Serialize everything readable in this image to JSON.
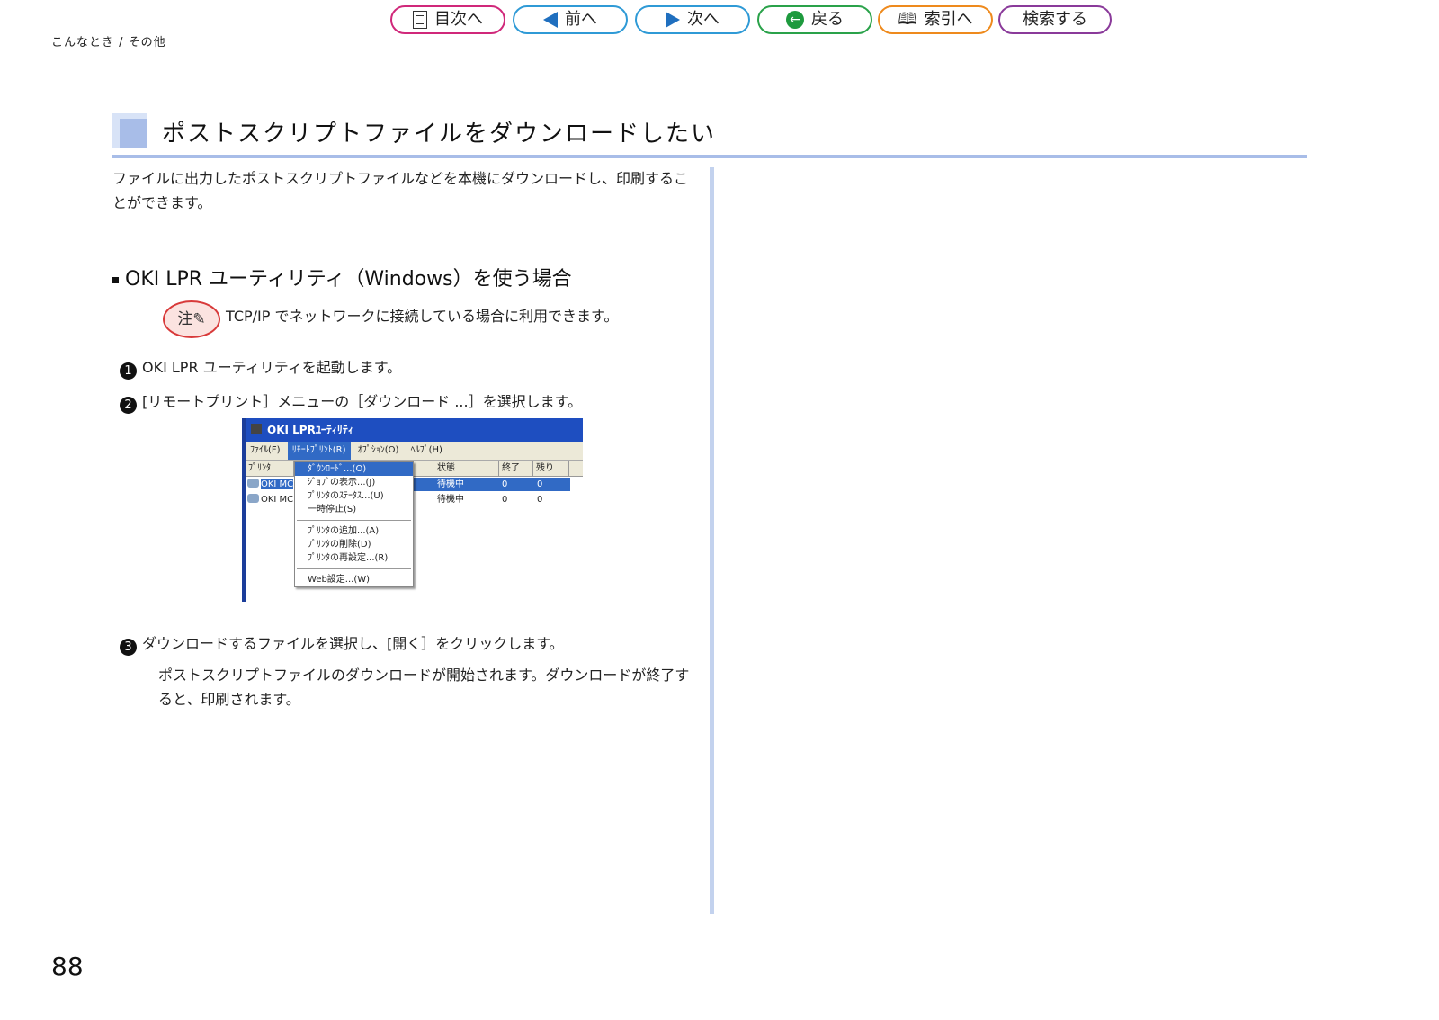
{
  "nav": {
    "toc": "目次へ",
    "prev": "前へ",
    "next": "次へ",
    "back": "戻る",
    "index": "索引へ",
    "search": "検索する"
  },
  "breadcrumb": "こんなとき / その他",
  "title": "ポストスクリプトファイルをダウンロードしたい",
  "intro": "ファイルに出力したポストスクリプトファイルなどを本機にダウンロードし、印刷することができます。",
  "section": {
    "heading": "OKI LPR ユーティリティ（Windows）を使う場合",
    "note_badge": "注",
    "note_text": "TCP/IP でネットワークに接続している場合に利用できます。"
  },
  "steps": [
    {
      "num": "1",
      "text": "OKI LPR ユーティリティを起動します。"
    },
    {
      "num": "2",
      "text": "[リモートプリント］メニューの［ダウンロード ...］を選択します。"
    },
    {
      "num": "3",
      "text": "ダウンロードするファイルを選択し、[開く］をクリックします。"
    }
  ],
  "result": "ポストスクリプトファイルのダウンロードが開始されます。ダウンロードが終了すると、印刷されます。",
  "screenshot": {
    "window_title": "OKI LPRﾕｰﾃｨﾘﾃｨ",
    "menus": [
      "ﾌｧｲﾙ(F)",
      "ﾘﾓｰﾄﾌﾟﾘﾝﾄ(R)",
      "ｵﾌﾟｼｮﾝ(O)",
      "ﾍﾙﾌﾟ(H)"
    ],
    "columns": [
      "ﾌﾟﾘﾝﾀ",
      "状態",
      "終了",
      "残り"
    ],
    "rows": [
      {
        "printer": "OKI MC",
        "status": "待機中",
        "done": "0",
        "remaining": "0"
      },
      {
        "printer": "OKI MC",
        "status": "待機中",
        "done": "0",
        "remaining": "0"
      }
    ],
    "dropdown": [
      "ﾀﾞｳﾝﾛｰﾄﾞ...(O)",
      "ｼﾞｮﾌﾞの表示...(J)",
      "ﾌﾟﾘﾝﾀのｽﾃｰﾀｽ...(U)",
      "一時停止(S)",
      "ﾌﾟﾘﾝﾀの追加...(A)",
      "ﾌﾟﾘﾝﾀの削除(D)",
      "ﾌﾟﾘﾝﾀの再設定...(R)",
      "Web設定...(W)"
    ]
  },
  "page_number": "88",
  "colors": {
    "accent_blue": "#a8bde8",
    "toc": "#d0287a",
    "prev_next": "#2f9ad6",
    "back": "#2aa24a",
    "index": "#ee8a1d",
    "search": "#8a3a9a"
  }
}
